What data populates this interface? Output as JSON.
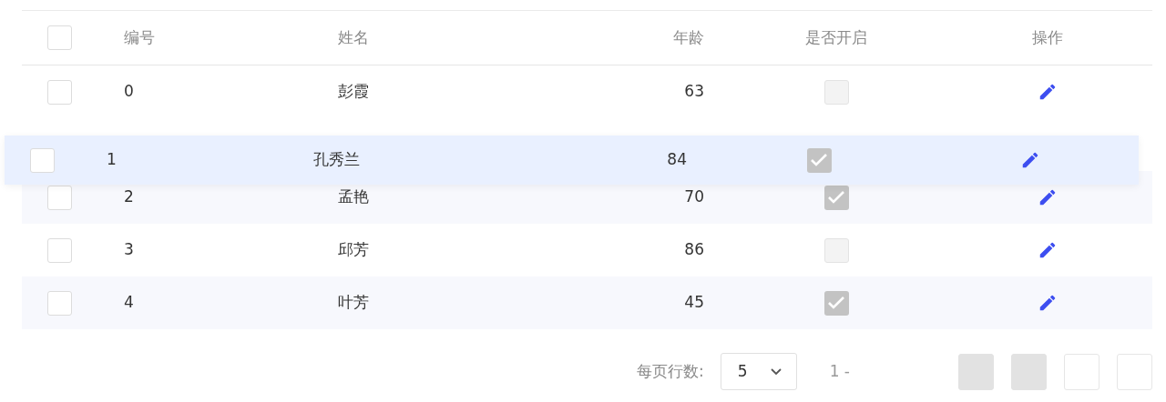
{
  "table": {
    "columns": [
      "编号",
      "姓名",
      "年龄",
      "是否开启",
      "操作"
    ],
    "header_checkbox": {
      "checked": false
    },
    "rows": [
      {
        "id": "0",
        "name": "彭霞",
        "age": "63",
        "enabled": false,
        "selected": false,
        "dragging": false
      },
      {
        "id": "1",
        "name": "孔秀兰",
        "age": "84",
        "enabled": true,
        "selected": false,
        "dragging": true
      },
      {
        "id": "2",
        "name": "孟艳",
        "age": "70",
        "enabled": true,
        "selected": false,
        "dragging": false
      },
      {
        "id": "3",
        "name": "邱芳",
        "age": "86",
        "enabled": false,
        "selected": false,
        "dragging": false
      },
      {
        "id": "4",
        "name": "叶芳",
        "age": "45",
        "enabled": true,
        "selected": false,
        "dragging": false
      }
    ]
  },
  "pagination": {
    "rows_per_page_label": "每页行数:",
    "rows_per_page": "5",
    "range": "1 -",
    "buttons": [
      {
        "disabled": true
      },
      {
        "disabled": true
      },
      {
        "disabled": false
      },
      {
        "disabled": false
      }
    ]
  }
}
